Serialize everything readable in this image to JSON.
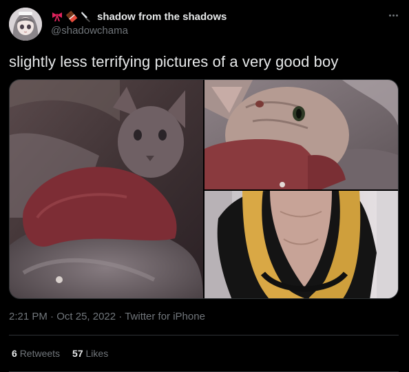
{
  "author": {
    "display_name": "shadow from the shadows",
    "handle": "@shadowchama",
    "name_emojis": [
      "ribbon-emoji",
      "chocolate-bar-emoji",
      "knife-emoji"
    ],
    "avatar_icon": "avatar-anime-girl"
  },
  "tweet": {
    "text": "slightly less terrifying pictures of a very good boy",
    "time": "2:21 PM",
    "separator": " · ",
    "date": "Oct 25, 2022",
    "source": "Twitter for iPhone"
  },
  "media": {
    "count": 3,
    "photos": [
      "photo-hairless-cat-red-sweater",
      "photo-hairless-cat-closeup",
      "photo-hairless-cat-vest"
    ]
  },
  "stats": {
    "retweets_count": "6",
    "retweets_label": "Retweets",
    "likes_count": "57",
    "likes_label": "Likes"
  },
  "colors": {
    "background": "#000000",
    "text": "#e7e9ea",
    "secondary": "#71767b",
    "border": "#2f3336"
  }
}
